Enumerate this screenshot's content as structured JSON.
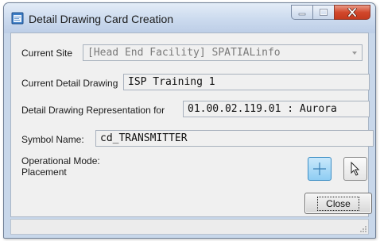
{
  "window": {
    "title": "Detail Drawing Card Creation",
    "title_icon": "app-window-icon",
    "caption_buttons": [
      "minimize-icon",
      "maximize-icon",
      "close-icon"
    ]
  },
  "form": {
    "current_site": {
      "label": "Current Site",
      "value": "[Head End Facility] SPATIALinfo"
    },
    "current_detail_drawing": {
      "label": "Current Detail Drawing",
      "value": "ISP Training 1"
    },
    "representation": {
      "label": "Detail Drawing Representation for",
      "value": "01.00.02.119.01 : Aurora"
    },
    "symbol_name": {
      "label": "Symbol Name:",
      "value": "cd_TRANSMITTER"
    },
    "operational_mode": {
      "label": "Operational Mode:",
      "value": "Placement"
    },
    "tools": [
      {
        "icon": "crosshair-icon",
        "selected": true
      },
      {
        "icon": "pointer-arrow-icon",
        "selected": false
      }
    ],
    "close_label": "Close"
  },
  "colors": {
    "window_frame": "#c8d7ea",
    "close_caption_red": "#c43a1e",
    "selected_tool_blue": "#8fcdf3"
  }
}
